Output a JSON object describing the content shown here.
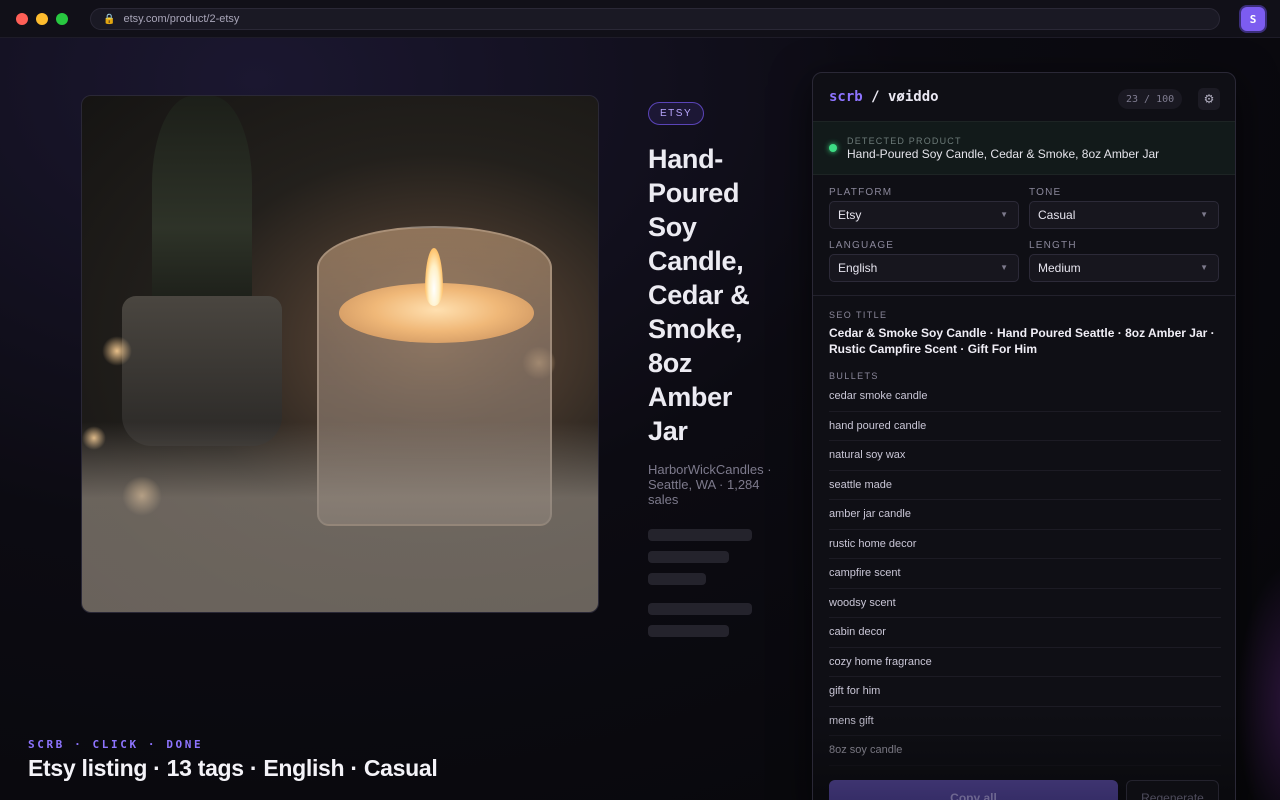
{
  "browser": {
    "url": "etsy.com/product/2-etsy",
    "extension_icon_letter": "S",
    "lock_icon": "lock-icon"
  },
  "product": {
    "platform_badge": "ETSY",
    "title": "Hand-Poured Soy Candle, Cedar & Smoke, 8oz Amber Jar",
    "seller": "HarborWickCandles · Seattle, WA · 1,284 sales"
  },
  "panel": {
    "brand_prefix": "scrb",
    "brand_suffix": " / vøiddo",
    "usage": "23 / 100",
    "settings_icon": "gear-icon",
    "detected_label": "DETECTED PRODUCT",
    "detected_value": "Hand-Poured Soy Candle, Cedar & Smoke, 8oz Amber Jar",
    "fields": {
      "platform_label": "PLATFORM",
      "platform_value": "Etsy",
      "tone_label": "TONE",
      "tone_value": "Casual",
      "language_label": "LANGUAGE",
      "language_value": "English",
      "length_label": "LENGTH",
      "length_value": "Medium"
    },
    "seo_label": "SEO TITLE",
    "seo_title": "Cedar & Smoke Soy Candle · Hand Poured Seattle · 8oz Amber Jar · Rustic Campfire Scent · Gift For Him",
    "bullets_label": "BULLETS",
    "bullets": [
      "cedar smoke candle",
      "hand poured candle",
      "natural soy wax",
      "seattle made",
      "amber jar candle",
      "rustic home decor",
      "campfire scent",
      "woodsy scent",
      "cabin decor",
      "cozy home fragrance",
      "gift for him",
      "mens gift",
      "8oz soy candle"
    ],
    "copy_all_label": "Copy all",
    "regenerate_label": "Regenerate"
  },
  "caption": {
    "eyebrow": "SCRB · CLICK · DONE",
    "main": "Etsy listing · 13 tags · English · Casual"
  },
  "colors": {
    "accent": "#8e74ff",
    "status_green": "#3ddc84"
  }
}
